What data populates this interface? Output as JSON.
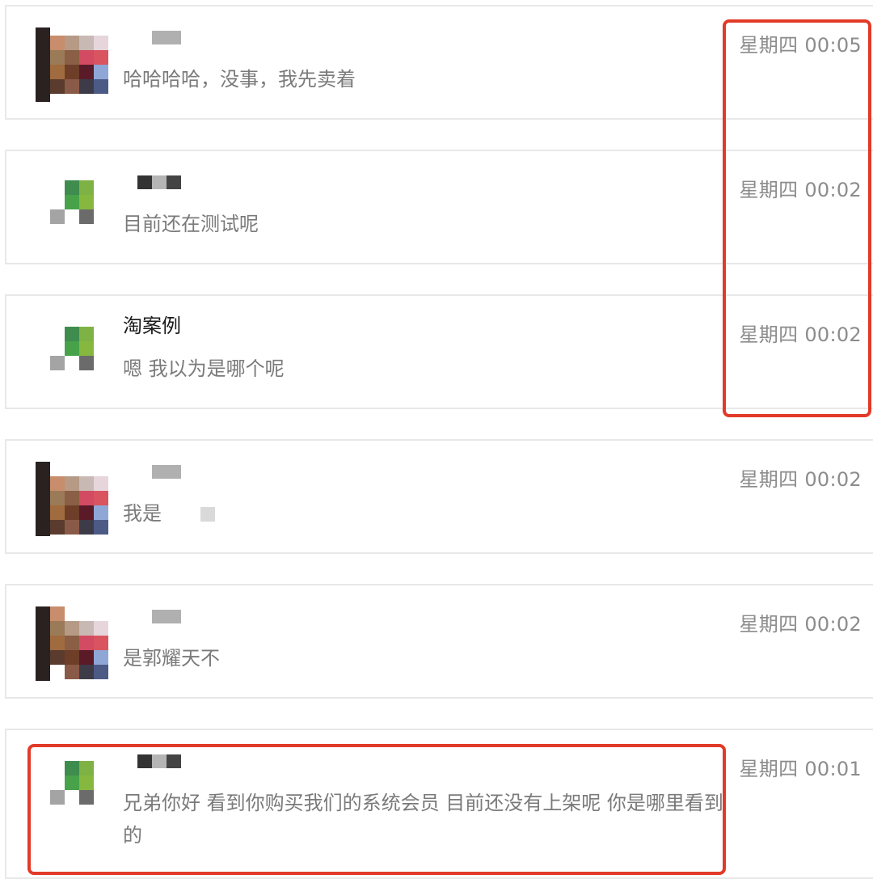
{
  "colors": {
    "highlight": "#e23a28",
    "muted_text": "#7a7a7a",
    "time_text": "#8c8c8c",
    "name_text": "#1a1a1a"
  },
  "chats": [
    {
      "name": "",
      "avatar": "photo-avatar",
      "message": "哈哈哈哈，没事，我先卖着",
      "time": "星期四 00:05"
    },
    {
      "name": "",
      "avatar": "logo-avatar",
      "message": "目前还在测试呢",
      "time": "星期四 00:02"
    },
    {
      "name": "淘案例",
      "avatar": "logo-avatar",
      "message": "嗯 我以为是哪个呢",
      "time": "星期四 00:02"
    },
    {
      "name": "",
      "avatar": "photo-avatar",
      "message": "我是",
      "time": "星期四 00:02"
    },
    {
      "name": "",
      "avatar": "photo-avatar",
      "message": "是郭耀天不",
      "time": "星期四 00:02"
    },
    {
      "name": "",
      "avatar": "logo-avatar",
      "message": "兄弟你好 看到你购买我们的系统会员 目前还没有上架呢 你是哪里看到的",
      "time": "星期四 00:01"
    }
  ]
}
